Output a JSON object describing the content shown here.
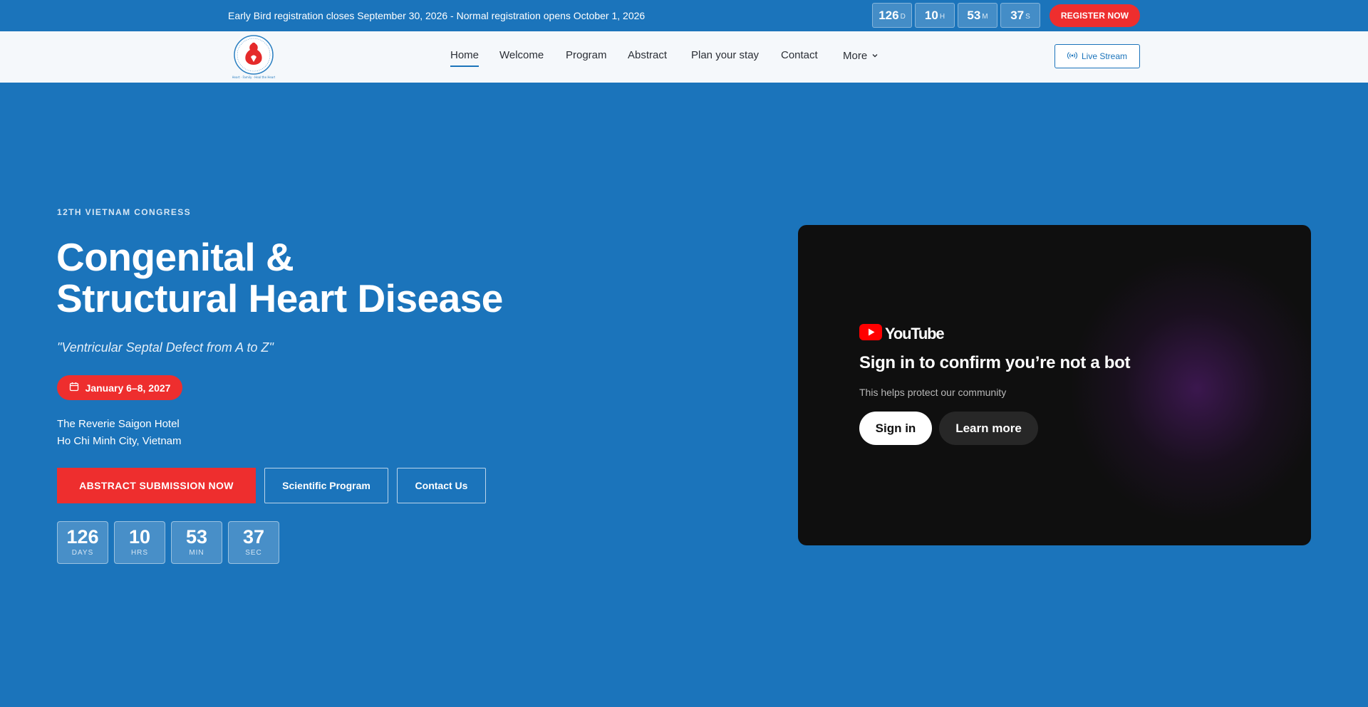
{
  "topbar": {
    "announcement": "Early Bird registration closes September 30, 2026 - Normal registration opens October 1, 2026",
    "timer": [
      {
        "value": "126",
        "unit": "D"
      },
      {
        "value": "10",
        "unit": "H"
      },
      {
        "value": "53",
        "unit": "M"
      },
      {
        "value": "37",
        "unit": "S"
      }
    ],
    "register_label": "REGISTER NOW"
  },
  "nav": {
    "items": [
      "Home",
      "Welcome",
      "Program",
      "Abstract",
      "Plan your stay",
      "Contact",
      "More"
    ],
    "active": "Home",
    "livestream_label": "Live Stream"
  },
  "hero": {
    "eyebrow": "12TH VIETNAM CONGRESS",
    "title_line1": "Congenital &",
    "title_line2": "Structural Heart Disease",
    "subtitle": "\"Ventricular Septal Defect from A to Z\"",
    "date": "January 6–8, 2027",
    "venue_line1": "The Reverie Saigon Hotel",
    "venue_line2": "Ho Chi Minh City, Vietnam",
    "buttons": {
      "abstract": "ABSTRACT SUBMISSION NOW",
      "program": "Scientific Program",
      "contact": "Contact Us"
    },
    "countdown": [
      {
        "value": "126",
        "label": "DAYS"
      },
      {
        "value": "10",
        "label": "HRS"
      },
      {
        "value": "53",
        "label": "MIN"
      },
      {
        "value": "37",
        "label": "SEC"
      }
    ]
  },
  "video": {
    "brand": "YouTube",
    "heading": "Sign in to confirm you’re not a bot",
    "subtext": "This helps protect our community",
    "signin_label": "Sign in",
    "learn_label": "Learn more"
  },
  "colors": {
    "background": "#1b74bb",
    "accent_red": "#ee2e2e",
    "nav_bg": "#f5f8fb",
    "video_bg": "#0f0f0f"
  }
}
